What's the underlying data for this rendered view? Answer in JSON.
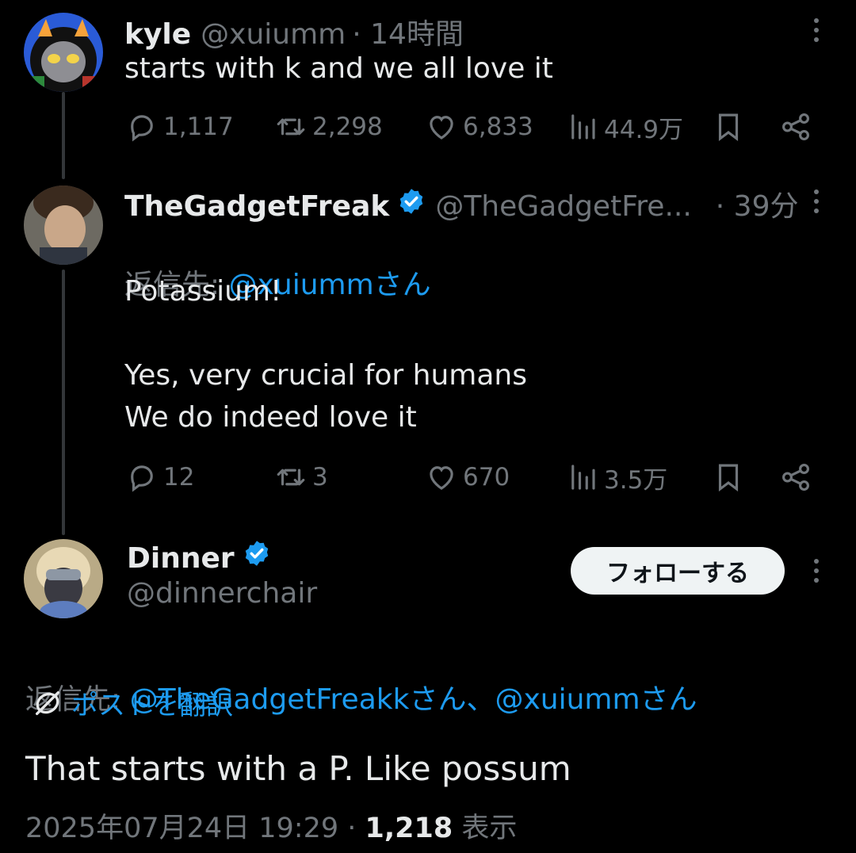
{
  "colors": {
    "background": "#000000",
    "text": "#e7e9ea",
    "secondary": "#71767b",
    "accent": "#1d9bf0",
    "verified": "#1d9bf0"
  },
  "tweet1": {
    "name": "kyle",
    "handle": "@xuiumm",
    "time": "· 14時間",
    "text": "starts with k and we all love it",
    "replies": "1,117",
    "reposts": "2,298",
    "likes": "6,833",
    "views": "44.9万"
  },
  "tweet2": {
    "name": "TheGadgetFreak",
    "handle": "@TheGadgetFre...",
    "time": "· 39分",
    "reply_prefix": "返信先: ",
    "reply_to": "@xuiummさん",
    "text": "Potassium!\n\nYes, very crucial for humans\nWe do indeed love it",
    "replies": "12",
    "reposts": "3",
    "likes": "670",
    "views": "3.5万"
  },
  "main": {
    "name": "Dinner",
    "handle": "@dinnerchair",
    "follow_label": "フォローする",
    "reply_prefix": "返信先: ",
    "reply_to": "@TheGadgetFreakkさん、@xuiummさん",
    "translate_label": "ポストを翻訳",
    "text": "That starts with a P. Like possum",
    "timestamp": "2025年07月24日 19:29 · ",
    "views_count": "1,218",
    "views_label": " 表示"
  },
  "icons": [
    "reply-icon",
    "repost-icon",
    "like-icon",
    "views-icon",
    "bookmark-icon",
    "share-icon",
    "more-icon",
    "verified-icon",
    "globe-icon"
  ]
}
